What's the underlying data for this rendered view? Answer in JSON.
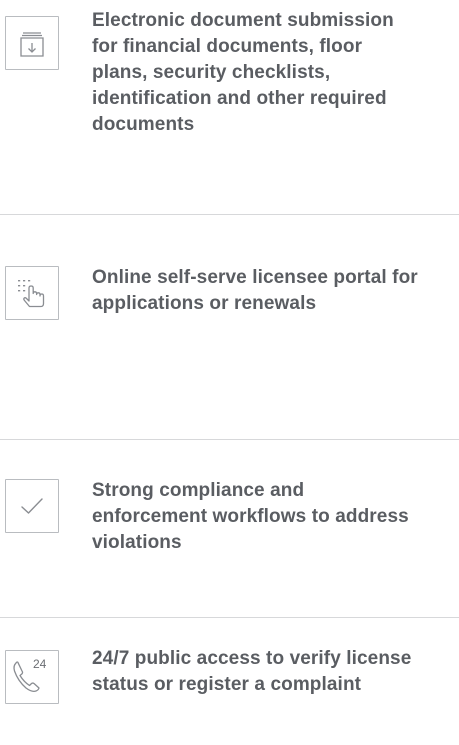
{
  "features": [
    {
      "icon": "document-download-icon",
      "text": "Electronic document submission for financial documents, floor plans, security checklists, identification and other required documents"
    },
    {
      "icon": "touch-grid-icon",
      "text": "Online self-serve licensee portal for applications or renewals"
    },
    {
      "icon": "checkmark-icon",
      "text": "Strong compliance and enforcement workflows to address violations"
    },
    {
      "icon": "phone-24-icon",
      "icon_label": "24",
      "text": "24/7 public access to verify license status or register a complaint"
    }
  ],
  "colors": {
    "text": "#5a5d62",
    "icon_stroke": "#8a8d92",
    "box_border": "#b9bcc0",
    "divider": "#d7d8da"
  }
}
